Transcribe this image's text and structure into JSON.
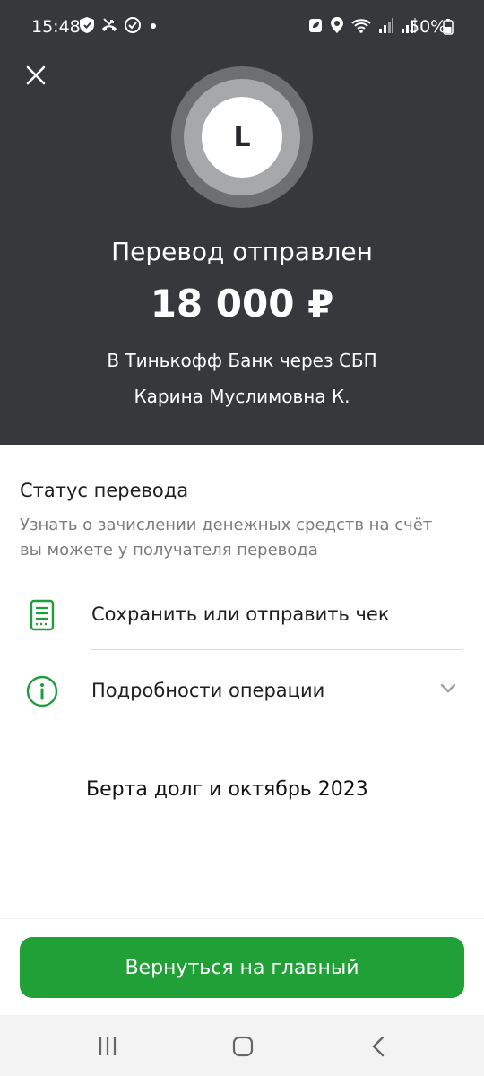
{
  "status_bar": {
    "time": "15:48",
    "battery": "50%",
    "icons_left": [
      "shield-icon",
      "missed-call-icon",
      "check-circle-icon",
      "dot-icon"
    ],
    "icons_right": [
      "eco-icon",
      "location-icon",
      "wifi-icon",
      "signal-icon",
      "signal-icon"
    ]
  },
  "header": {
    "avatar_letter": "L",
    "title": "Перевод отправлен",
    "amount": "18 000 ₽",
    "bank": "В Тинькофф Банк через СБП",
    "recipient": "Карина Муслимовна К."
  },
  "status": {
    "title": "Статус перевода",
    "description": "Узнать о зачислении денежных средств на счёт вы можете у получателя перевода"
  },
  "actions": [
    {
      "label": "Сохранить или отправить чек",
      "icon": "receipt-icon"
    },
    {
      "label": "Подробности операции",
      "icon": "info-icon"
    }
  ],
  "comment": "Берта долг и октябрь 2023",
  "main_button": "Вернуться на главный",
  "colors": {
    "header_bg": "#36383c",
    "accent_green": "#21a038",
    "icon_green": "#1f9c3c"
  },
  "nav_bar": [
    "recent-apps-icon",
    "home-icon",
    "back-icon"
  ]
}
